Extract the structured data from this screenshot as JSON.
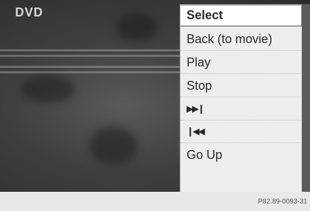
{
  "screen": {
    "source_label": "DVD"
  },
  "menu": {
    "items": [
      {
        "label": "Select",
        "icon": ""
      },
      {
        "label": "Back (to movie)",
        "icon": ""
      },
      {
        "label": "Play",
        "icon": ""
      },
      {
        "label": "Stop",
        "icon": ""
      },
      {
        "label": "",
        "icon": "skip-forward-icon",
        "glyph": "▶▶I"
      },
      {
        "label": "",
        "icon": "skip-back-icon",
        "glyph": "I◀◀"
      },
      {
        "label": "Go Up",
        "icon": ""
      }
    ],
    "selected_index": 0
  },
  "figure_ref": "P82.89-0093-31"
}
